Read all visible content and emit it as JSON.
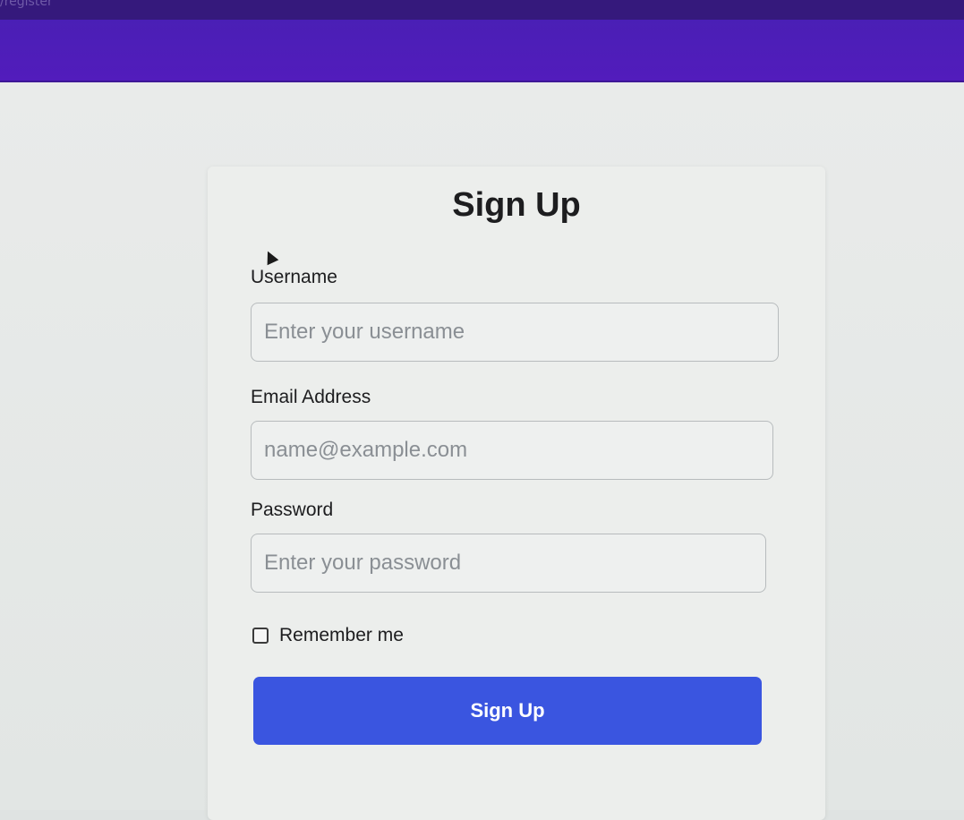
{
  "browser": {
    "url_fragment": "/register"
  },
  "form": {
    "title": "Sign Up",
    "fields": [
      {
        "label": "Username",
        "placeholder": "Enter your username",
        "value": ""
      },
      {
        "label": "Email Address",
        "placeholder": "name@example.com",
        "value": ""
      },
      {
        "label": "Password",
        "placeholder": "Enter your password",
        "value": ""
      }
    ],
    "remember": {
      "label": "Remember me",
      "checked": false
    },
    "submit_label": "Sign Up"
  },
  "colors": {
    "header": "#4a1fb5",
    "button": "#3a55e0",
    "background": "#e6e9e8"
  }
}
